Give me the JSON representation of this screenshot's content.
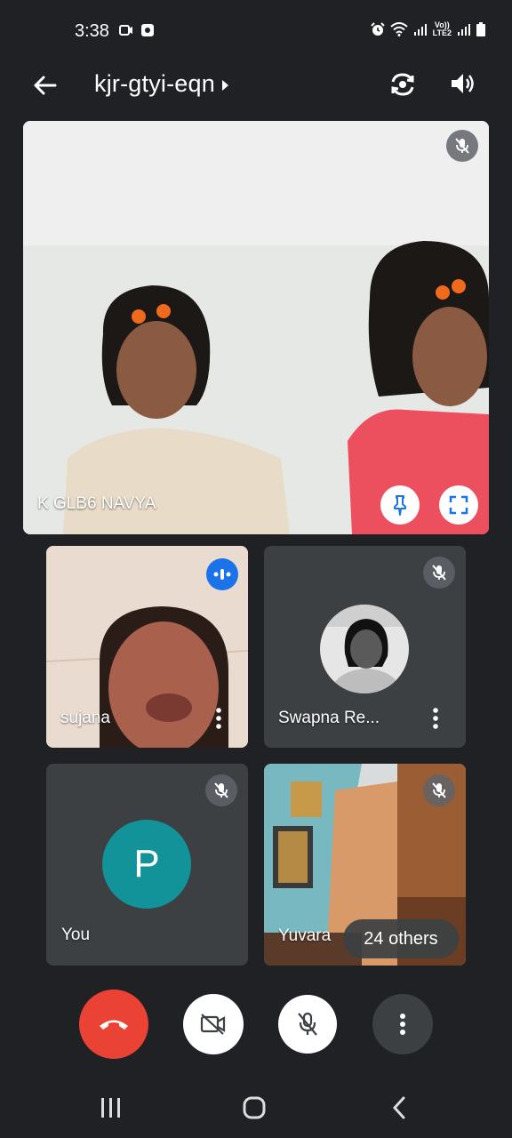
{
  "status_bar": {
    "time": "3:38",
    "network_label_top": "Vo))",
    "network_label_bottom": "LTE2"
  },
  "header": {
    "meeting_code": "kjr-gtyi-eqn"
  },
  "main_tile": {
    "participant_name": "K GLB6 NAVYA"
  },
  "tiles": [
    {
      "name": "sujana"
    },
    {
      "name": "Swapna Re..."
    },
    {
      "name": "You",
      "avatar_letter": "P"
    },
    {
      "name": "Yuvara"
    }
  ],
  "others_chip": "24 others",
  "colors": {
    "background": "#202124",
    "tile": "#3c4043",
    "end_call": "#ea4335",
    "avatar": "#12939a",
    "speaking": "#1a73e8"
  },
  "icons": {
    "back": "arrow-left",
    "switch_camera": "switch-camera",
    "speaker": "volume",
    "pin": "pin",
    "fullscreen": "fullscreen",
    "mic_off": "mic-off",
    "camera_off": "videocam-off",
    "end_call": "call-end",
    "more": "more-vert"
  }
}
